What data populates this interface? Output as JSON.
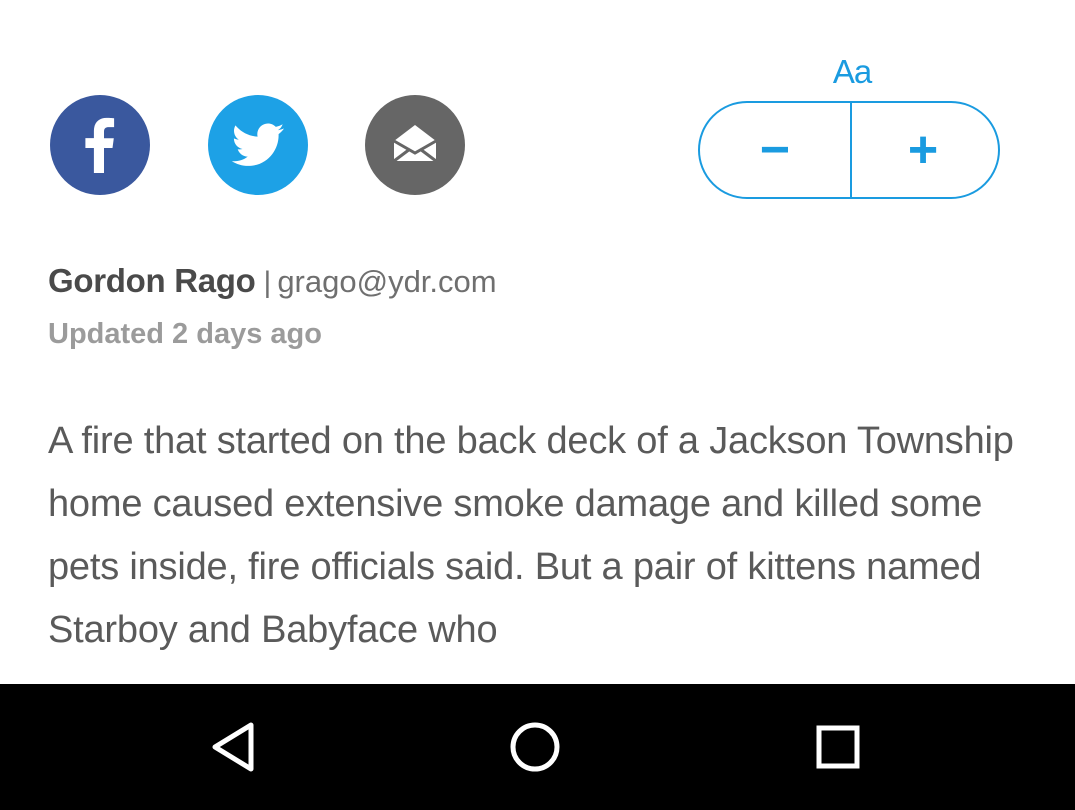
{
  "colors": {
    "facebook": "#3a589e",
    "twitter": "#1da1e6",
    "email": "#666666",
    "accent": "#1a9be0",
    "author": "#4a4a4a",
    "email_text": "#6f6f6f",
    "updated": "#9b9b9b",
    "body_text": "#5a5a5a",
    "nav_bar": "#000000",
    "nav_icon": "#ffffff"
  },
  "share": {
    "facebook_icon": "facebook-icon",
    "twitter_icon": "twitter-icon",
    "email_icon": "email-envelope-icon"
  },
  "font_size": {
    "label": "Aa",
    "decrease": "−",
    "increase": "+"
  },
  "byline": {
    "author": "Gordon Rago",
    "separator": "|",
    "email": "grago@ydr.com",
    "updated": "Updated 2 days ago"
  },
  "article": {
    "body": "A fire that started on the back deck of a Jackson Township home caused extensive smoke damage and killed some pets inside, fire officials said. But a pair of kittens named Starboy and Babyface who"
  },
  "nav": {
    "back_icon": "back-triangle-icon",
    "home_icon": "home-circle-icon",
    "recent_icon": "recent-apps-square-icon"
  }
}
